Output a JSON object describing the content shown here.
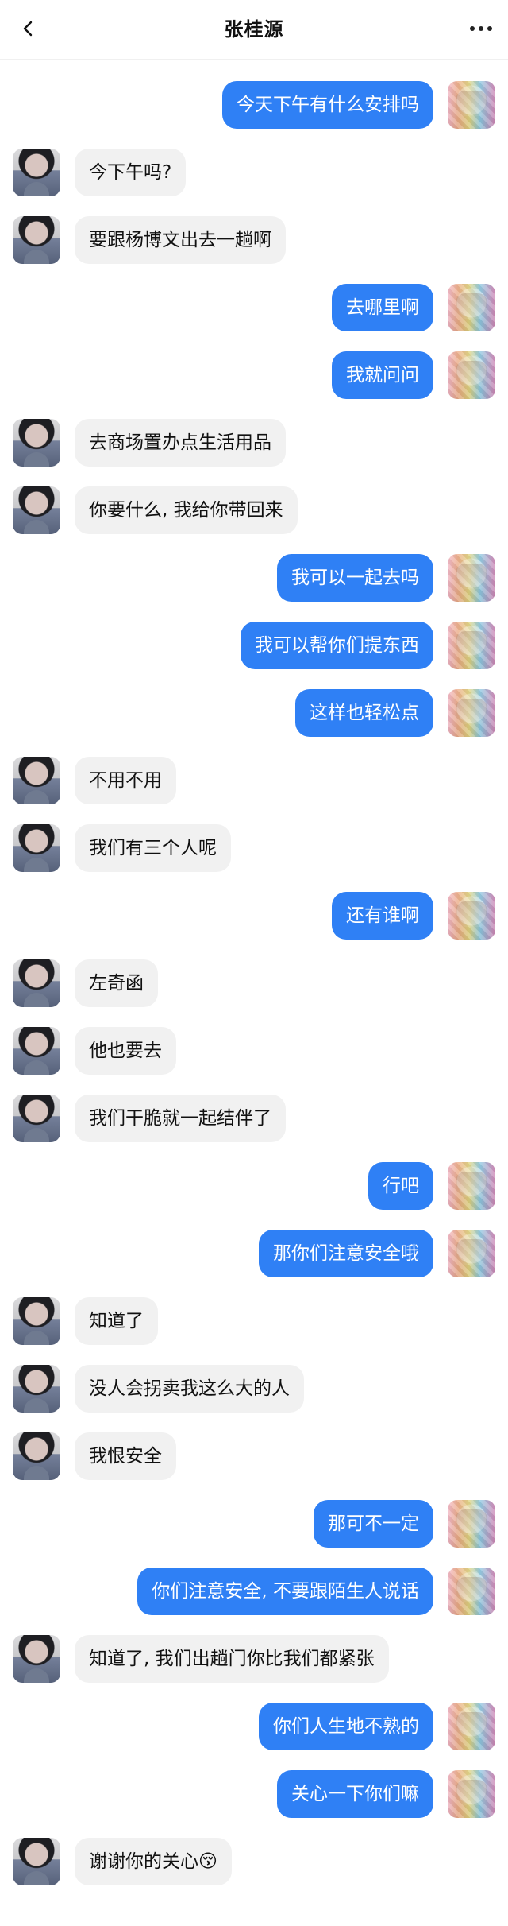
{
  "header": {
    "title": "张桂源"
  },
  "messages": [
    {
      "side": "right",
      "text": "今天下午有什么安排吗"
    },
    {
      "side": "left",
      "text": "今下午吗?"
    },
    {
      "side": "left",
      "text": "要跟杨博文出去一趟啊"
    },
    {
      "side": "right",
      "text": "去哪里啊"
    },
    {
      "side": "right",
      "text": "我就问问"
    },
    {
      "side": "left",
      "text": "去商场置办点生活用品"
    },
    {
      "side": "left",
      "text": "你要什么, 我给你带回来"
    },
    {
      "side": "right",
      "text": "我可以一起去吗"
    },
    {
      "side": "right",
      "text": "我可以帮你们提东西"
    },
    {
      "side": "right",
      "text": "这样也轻松点"
    },
    {
      "side": "left",
      "text": "不用不用"
    },
    {
      "side": "left",
      "text": "我们有三个人呢"
    },
    {
      "side": "right",
      "text": "还有谁啊"
    },
    {
      "side": "left",
      "text": "左奇函"
    },
    {
      "side": "left",
      "text": "他也要去"
    },
    {
      "side": "left",
      "text": "我们干脆就一起结伴了"
    },
    {
      "side": "right",
      "text": "行吧"
    },
    {
      "side": "right",
      "text": "那你们注意安全哦"
    },
    {
      "side": "left",
      "text": "知道了"
    },
    {
      "side": "left",
      "text": "没人会拐卖我这么大的人"
    },
    {
      "side": "left",
      "text": "我恨安全"
    },
    {
      "side": "right",
      "text": "那可不一定"
    },
    {
      "side": "right",
      "text": "你们注意安全, 不要跟陌生人说话"
    },
    {
      "side": "left",
      "text": "知道了, 我们出趟门你比我们都紧张"
    },
    {
      "side": "right",
      "text": "你们人生地不熟的"
    },
    {
      "side": "right",
      "text": "关心一下你们嘛"
    },
    {
      "side": "left",
      "text": "谢谢你的关心😚"
    }
  ]
}
